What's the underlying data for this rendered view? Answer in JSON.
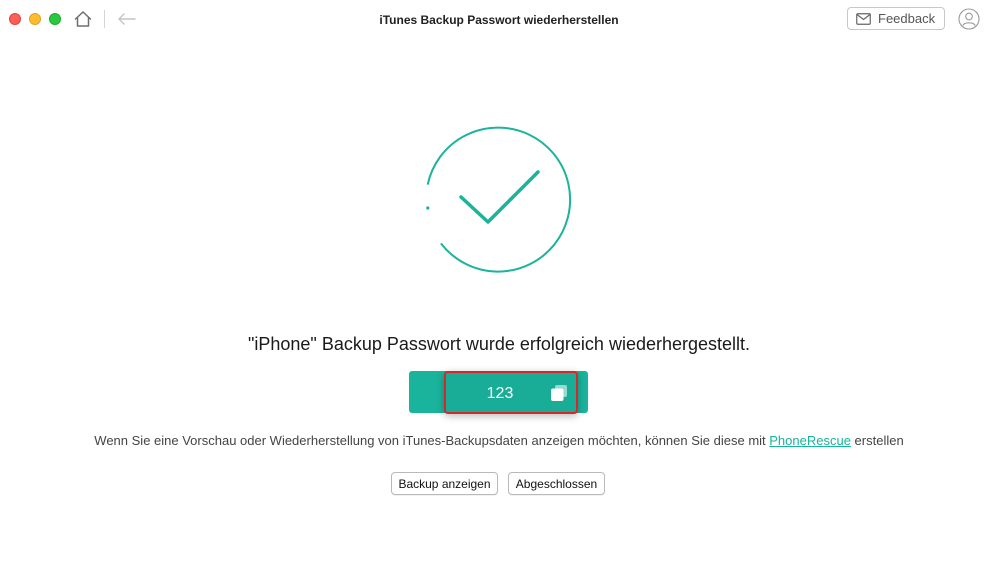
{
  "window": {
    "title": "iTunes Backup Passwort wiederherstellen"
  },
  "toolbar": {
    "home_icon": "home-icon",
    "back_icon": "back-arrow-icon",
    "feedback_label": "Feedback",
    "feedback_icon": "mail-icon",
    "user_icon": "user-icon"
  },
  "result": {
    "status_icon": "checkmark-circle-icon",
    "headline": "\"iPhone\" Backup Passwort wurde erfolgreich wiederhergestellt.",
    "password": "123",
    "copy_icon": "copy-icon"
  },
  "info": {
    "text_before": "Wenn Sie eine Vorschau oder Wiederherstellung von iTunes-Backupsdaten anzeigen möchten, können Sie diese mit ",
    "link": "PhoneRescue",
    "text_after": " erstellen"
  },
  "actions": {
    "show_backup_label": "Backup anzeigen",
    "done_label": "Abgeschlossen"
  },
  "colors": {
    "accent": "#1ab39b",
    "highlight_border": "#d3292c",
    "close": "#fe5f57",
    "minimize": "#febc2e",
    "maximize": "#28c840"
  }
}
